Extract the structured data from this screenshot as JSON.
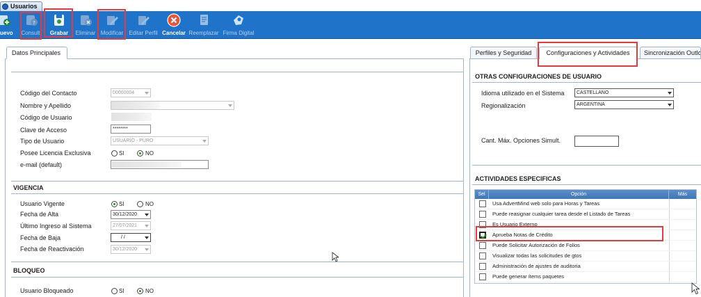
{
  "window": {
    "tab_title": "Usuarios"
  },
  "toolbar": {
    "buttons": [
      {
        "label": "uevo",
        "icon": "new-icon",
        "active": true
      },
      {
        "label": "Consult.",
        "icon": "consult-icon",
        "active": false
      },
      {
        "label": "Grabar",
        "icon": "save-icon",
        "active": true
      },
      {
        "label": "Eliminar",
        "icon": "delete-icon",
        "active": false
      },
      {
        "label": "Modificar",
        "icon": "edit-icon",
        "active": false
      },
      {
        "label": "Editar Perfil",
        "icon": "edit-profile-icon",
        "active": false
      },
      {
        "label": "Cancelar",
        "icon": "cancel-icon",
        "active": true
      },
      {
        "label": "Reemplazar",
        "icon": "replace-icon",
        "active": false
      },
      {
        "label": "Firma Digital",
        "icon": "digital-signature-icon",
        "active": false
      }
    ]
  },
  "left": {
    "tab": "Datos Principales",
    "fields": {
      "codigo_contacto": {
        "label": "Código del Contacto",
        "value": "00000004"
      },
      "nombre_apellido": {
        "label": "Nombre y Apellido"
      },
      "codigo_usuario": {
        "label": "Código de Usuario"
      },
      "clave_acceso": {
        "label": "Clave de Acceso",
        "value": "********"
      },
      "tipo_usuario": {
        "label": "Tipo de Usuario",
        "value": "USUARIO - PURO"
      },
      "licencia": {
        "label": "Posee Licencia Exclusiva",
        "opt_si": "SI",
        "opt_no": "NO",
        "selected": "NO"
      },
      "email": {
        "label": "e-mail (default)"
      }
    },
    "vigencia": {
      "title": "VIGENCIA",
      "vigente": {
        "label": "Usuario Vigente",
        "opt_si": "SI",
        "opt_no": "NO",
        "selected": "SI"
      },
      "fecha_alta": {
        "label": "Fecha de Alta",
        "value": "30/12/2020"
      },
      "ultimo_ingreso": {
        "label": "Último Ingreso al Sistema",
        "value": "27/07/2021"
      },
      "fecha_baja": {
        "label": "Fecha de Baja",
        "value": " /  /"
      },
      "fecha_reactivacion": {
        "label": "Fecha de Reactivación",
        "value": "30/12/2020"
      }
    },
    "bloqueo": {
      "title": "BLOQUEO",
      "bloqueado": {
        "label": "Usuario Bloqueado",
        "opt_si": "SI",
        "opt_no": "NO",
        "selected": "NO"
      }
    }
  },
  "right": {
    "tabs": [
      "Perfiles y Seguridad",
      "Configuraciones y Actividades",
      "Sincronización Outlo"
    ],
    "active_tab": "Configuraciones y Actividades",
    "otras": {
      "title": "OTRAS CONFIGURACIONES DE USUARIO",
      "idioma": {
        "label": "Idioma utilizado en el Sistema",
        "value": "CASTELLANO"
      },
      "regionalizacion": {
        "label": "Regionalización",
        "value": "ARGENTINA"
      },
      "cant_max": {
        "label": "Cant. Máx. Opciones Simult.",
        "value": ""
      }
    },
    "actividades": {
      "title": "ACTIVIDADES ESPECIFICAS",
      "columns": [
        "Sel",
        "Opción",
        "Más"
      ],
      "rows": [
        {
          "label": "Usa AdvertMind web solo para Horas y Tareas",
          "checked": false
        },
        {
          "label": "Puede reasignar cualquier tarea desde el Listado de Tareas",
          "checked": false
        },
        {
          "label": "Es Usuario Externo",
          "checked": false
        },
        {
          "label": "Aprueba Notas de Crédito",
          "checked": true
        },
        {
          "label": "Puede Solicitar Autorización de Folios",
          "checked": false
        },
        {
          "label": "Visualizar todas las solicitudes de gtos",
          "checked": false
        },
        {
          "label": "Administración de ajustes de auditoria",
          "checked": false
        },
        {
          "label": "Puede generar ítems paquetes",
          "checked": false
        }
      ]
    }
  },
  "colors": {
    "toolbar": "#1f73c8",
    "highlight": "#e53b3b",
    "grid_header": "#4a80be"
  }
}
